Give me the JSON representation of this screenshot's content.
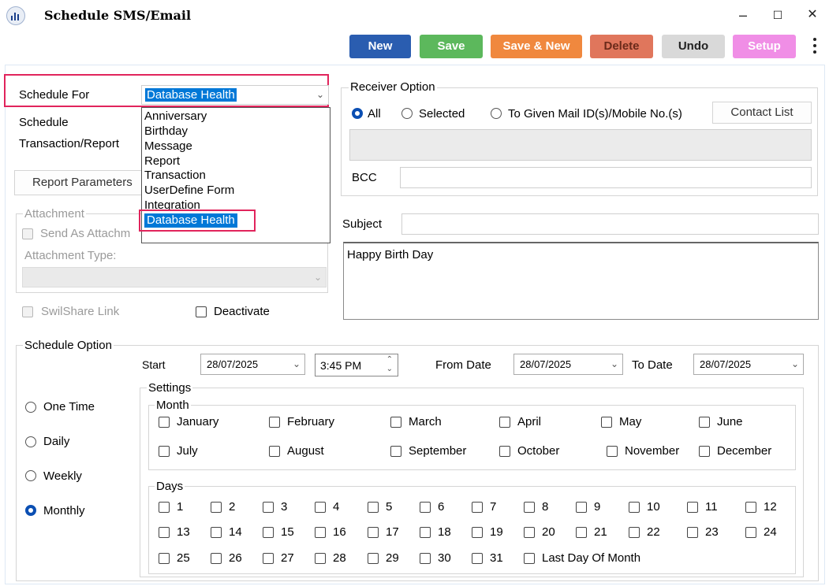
{
  "window": {
    "title": "Schedule SMS/Email",
    "min": "–",
    "max": "☐",
    "close": "✕"
  },
  "toolbar": {
    "new": "New",
    "save": "Save",
    "save_new": "Save & New",
    "delete": "Delete",
    "undo": "Undo",
    "setup": "Setup"
  },
  "schedule_for": {
    "label": "Schedule For",
    "value": "Database Health",
    "options": [
      "Anniversary",
      "Birthday",
      "Message",
      "Report",
      "Transaction",
      "UserDefine Form",
      "Integration",
      "Database Health"
    ]
  },
  "schedule_label": "Schedule",
  "transaction_report_label": "Transaction/Report",
  "report_parameters": "Report Parameters",
  "attachment": {
    "title": "Attachment",
    "send_as": "Send As Attachm",
    "type_label": "Attachment Type:"
  },
  "swilshare": "SwilShare Link",
  "deactivate": "Deactivate",
  "receiver": {
    "title": "Receiver Option",
    "all": "All",
    "selected": "Selected",
    "given": "To Given Mail ID(s)/Mobile No.(s)",
    "contact_list": "Contact List",
    "bcc": "BCC"
  },
  "subject_label": "Subject",
  "message_body": "Happy Birth Day",
  "schedule_option": {
    "title": "Schedule Option",
    "start_label": "Start",
    "start_date": "28/07/2025",
    "start_time": "3:45 PM",
    "from_label": "From Date",
    "from_date": "28/07/2025",
    "to_label": "To Date",
    "to_date": "28/07/2025",
    "frequency": [
      "One Time",
      "Daily",
      "Weekly",
      "Monthly"
    ],
    "settings": "Settings",
    "month_title": "Month",
    "months": [
      "January",
      "February",
      "March",
      "April",
      "May",
      "June",
      "July",
      "August",
      "September",
      "October",
      "November",
      "December"
    ],
    "days_title": "Days",
    "days": [
      "1",
      "2",
      "3",
      "4",
      "5",
      "6",
      "7",
      "8",
      "9",
      "10",
      "11",
      "12",
      "13",
      "14",
      "15",
      "16",
      "17",
      "18",
      "19",
      "20",
      "21",
      "22",
      "23",
      "24",
      "25",
      "26",
      "27",
      "28",
      "29",
      "30",
      "31"
    ],
    "last_day": "Last Day Of Month"
  },
  "colors": {
    "new": "#2a5db0",
    "save": "#5cb85c",
    "save_new": "#f0883e",
    "delete": "#e0765c",
    "undo": "#d9d9d9",
    "setup": "#f08ee6",
    "highlight": "#e1245c",
    "selection": "#0078d7"
  }
}
